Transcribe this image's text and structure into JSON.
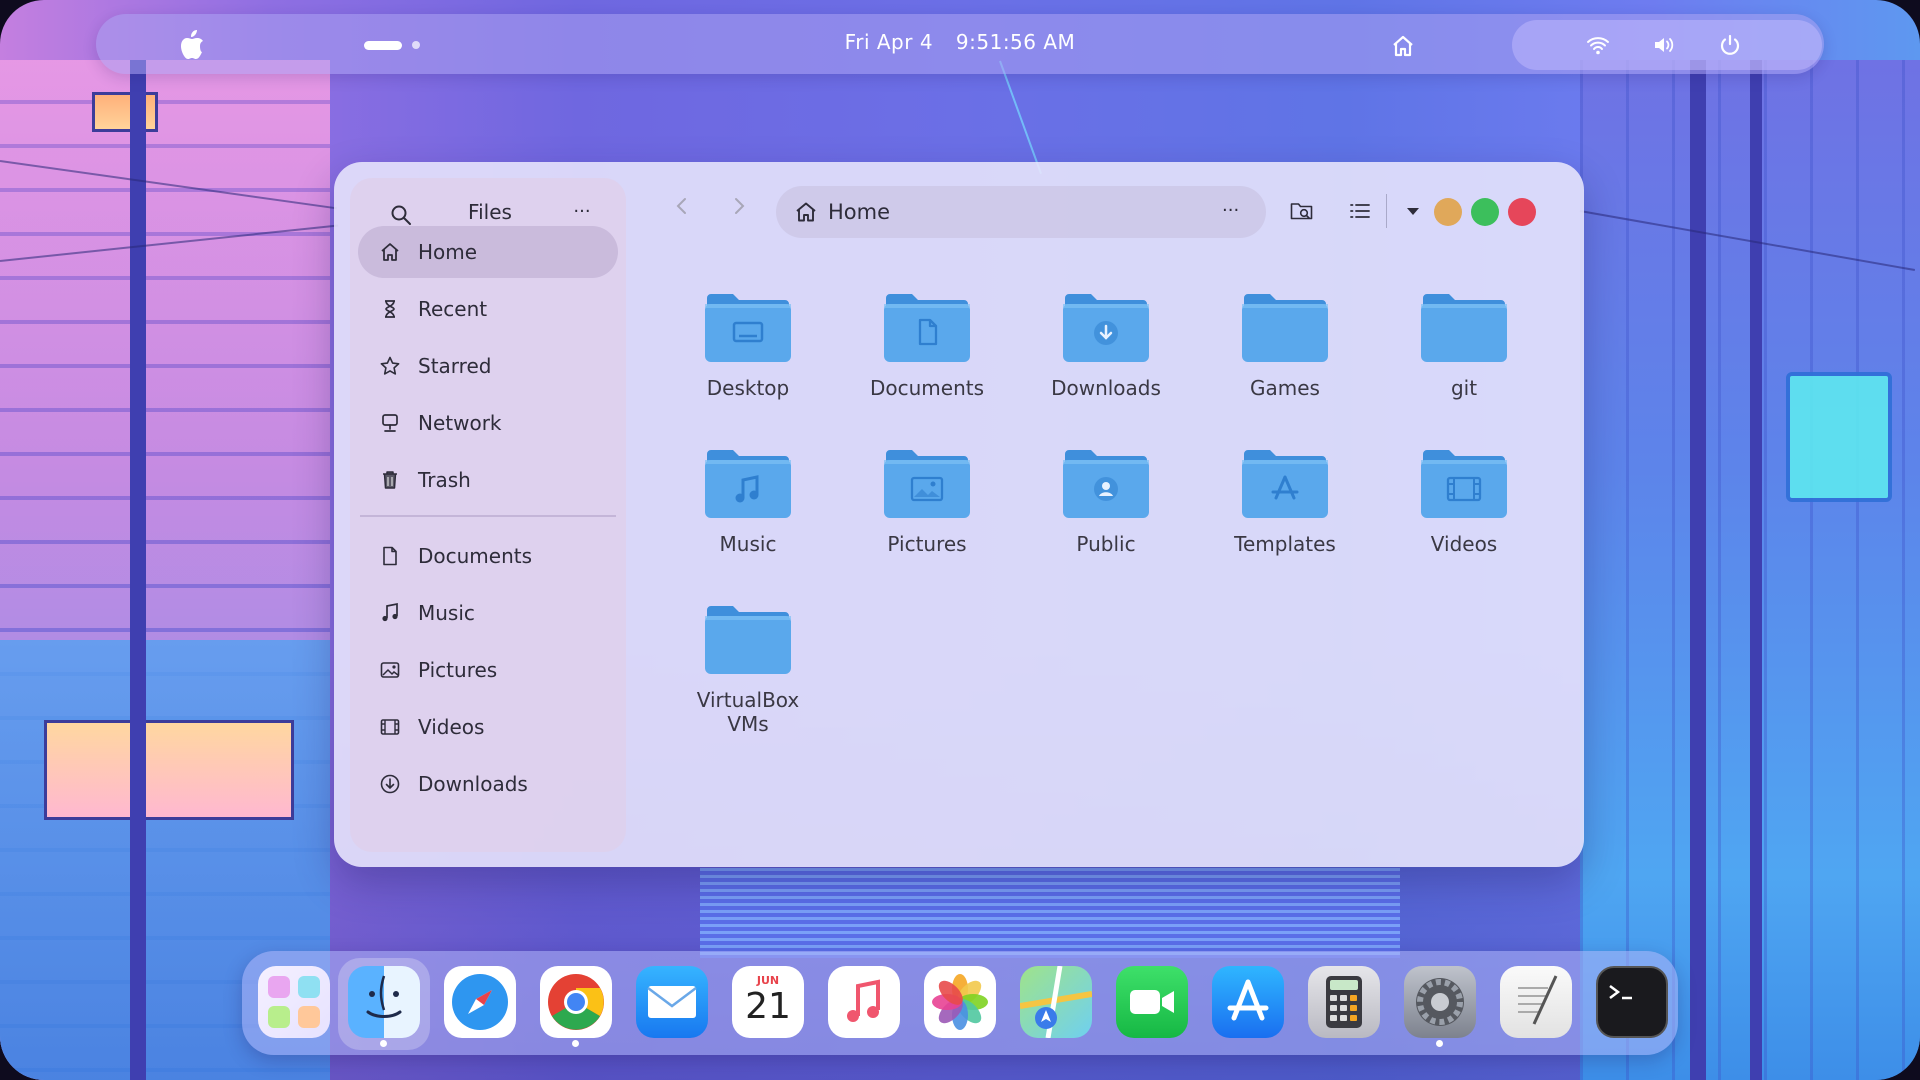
{
  "topbar": {
    "date": "Fri Apr 4",
    "time": "9:51:56 AM",
    "icons": [
      "apple-logo-icon",
      "home-icon",
      "wifi-icon",
      "volume-icon",
      "power-icon"
    ]
  },
  "window": {
    "sidebar": {
      "title": "Files",
      "more": "···",
      "places": [
        {
          "label": "Home",
          "icon": "home-icon",
          "active": true
        },
        {
          "label": "Recent",
          "icon": "hourglass-icon"
        },
        {
          "label": "Starred",
          "icon": "star-icon"
        },
        {
          "label": "Network",
          "icon": "network-icon"
        },
        {
          "label": "Trash",
          "icon": "trash-icon"
        }
      ],
      "bookmarks": [
        {
          "label": "Documents",
          "icon": "document-icon"
        },
        {
          "label": "Music",
          "icon": "music-note-icon"
        },
        {
          "label": "Pictures",
          "icon": "picture-icon"
        },
        {
          "label": "Videos",
          "icon": "film-icon"
        },
        {
          "label": "Downloads",
          "icon": "download-icon"
        }
      ]
    },
    "path": {
      "label": "Home",
      "more": "···"
    },
    "folders": [
      {
        "label": "Desktop",
        "glyph": "desktop"
      },
      {
        "label": "Documents",
        "glyph": "document"
      },
      {
        "label": "Downloads",
        "glyph": "download"
      },
      {
        "label": "Games",
        "glyph": "none"
      },
      {
        "label": "git",
        "glyph": "none"
      },
      {
        "label": "Music",
        "glyph": "music"
      },
      {
        "label": "Pictures",
        "glyph": "picture"
      },
      {
        "label": "Public",
        "glyph": "user"
      },
      {
        "label": "Templates",
        "glyph": "appstore"
      },
      {
        "label": "Videos",
        "glyph": "film"
      },
      {
        "label": "VirtualBox VMs",
        "glyph": "none"
      }
    ],
    "controls_colors": {
      "minimize": "#e0a85a",
      "maximize": "#3cbf5c",
      "close": "#e6465a"
    },
    "folder_color": "#5aa8ec"
  },
  "dock": {
    "calendar_month": "JUN",
    "calendar_day": "21",
    "apps": [
      "launchpad",
      "finder",
      "safari",
      "chrome",
      "mail",
      "calendar",
      "music",
      "photos",
      "maps",
      "facetime",
      "app-store",
      "calculator",
      "system-preferences",
      "textedit",
      "terminal"
    ],
    "running": [
      "finder",
      "chrome",
      "system-preferences"
    ]
  }
}
